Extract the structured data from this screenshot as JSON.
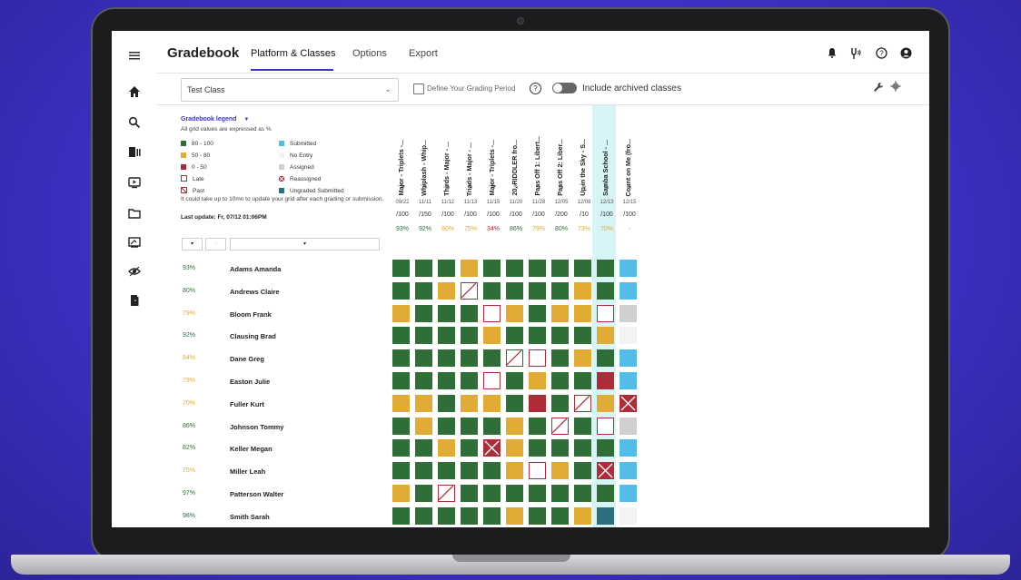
{
  "header": {
    "brand": "Gradebook",
    "tabs": [
      "Platform & Classes",
      "Options",
      "Export"
    ]
  },
  "sidebar": {
    "icons": [
      "menu-icon",
      "home-icon",
      "search-icon",
      "library-icon",
      "play-icon",
      "folder-icon",
      "chalkboard-icon",
      "eye-icon",
      "door-icon"
    ]
  },
  "toolbar": {
    "class_select": "Test Class",
    "period_label": "Define Your Grading Period",
    "archived_label": "Include archived classes"
  },
  "legend": {
    "title": "Gradebook legend",
    "subtitle": "All grid values are expressed as %",
    "items_left": [
      "80 - 100",
      "50 - 80",
      "0 - 50",
      "Late",
      "Past"
    ],
    "items_right": [
      "Submitted",
      "No Entry",
      "Assigned",
      "Reassigned",
      "Ungraded Submitted"
    ],
    "note": "It could take up to 10mn to update your grid after each grading or submission.",
    "last_update": "Last update: Fr, 07/12 01:06PM"
  },
  "filters": {
    "first": "▾",
    "second": "-",
    "third": "▾"
  },
  "colors": {
    "green": "#2f6e36",
    "yellow": "#e2ac34",
    "red": "#ae2c38",
    "blue": "#53bde9",
    "grey": "#cfcfcf",
    "teal": "#2c6f7f",
    "accent": "#3d33c6"
  },
  "columns": [
    {
      "title": "Major - Triplets -...",
      "date": "09/22",
      "max": "/100",
      "avg": "93%",
      "avg_color": "#2f6e36"
    },
    {
      "title": "Whiplash - Whip...",
      "date": "11/11",
      "max": "/150",
      "avg": "92%",
      "avg_color": "#2f6e36"
    },
    {
      "title": "Thirds - Major - ...",
      "date": "11/12",
      "max": "/100",
      "avg": "80%",
      "avg_color": "#e2ac34"
    },
    {
      "title": "Triads - Major - ...",
      "date": "11/13",
      "max": "/100",
      "avg": "75%",
      "avg_color": "#e2ac34"
    },
    {
      "title": "Major - Triplets -...",
      "date": "11/15",
      "max": "/100",
      "avg": "34%",
      "avg_color": "#ae2c38"
    },
    {
      "title": "20. RIDDLER fro...",
      "date": "11/20",
      "max": "/100",
      "avg": "86%",
      "avg_color": "#2f6e36"
    },
    {
      "title": "Pass Off 1: Libert...",
      "date": "11/28",
      "max": "/100",
      "avg": "79%",
      "avg_color": "#e2ac34"
    },
    {
      "title": "Pass Off 2: Liber...",
      "date": "12/05",
      "max": "/200",
      "avg": "80%",
      "avg_color": "#2f6e36"
    },
    {
      "title": "Up in the Sky - S...",
      "date": "12/08",
      "max": "/10",
      "avg": "73%",
      "avg_color": "#e2ac34"
    },
    {
      "title": "Samba School - ...",
      "date": "12/13",
      "max": "/100",
      "avg": "70%",
      "avg_color": "#e2ac34"
    },
    {
      "title": "Count on Me (fro...",
      "date": "12/15",
      "max": "/100",
      "avg": "-",
      "avg_color": "#999999"
    }
  ],
  "students": [
    {
      "name": "Adams Amanda",
      "pct": "93%",
      "pct_color": "#2f6e36",
      "cells": [
        "g",
        "g",
        "g",
        "y",
        "g",
        "g",
        "g",
        "g",
        "g",
        "g",
        "b"
      ]
    },
    {
      "name": "Andrews  Claire",
      "pct": "80%",
      "pct_color": "#2f6e36",
      "cells": [
        "g",
        "g",
        "y",
        "p",
        "g",
        "g",
        "g",
        "g",
        "y",
        "g",
        "b"
      ]
    },
    {
      "name": "Bloom Frank",
      "pct": "79%",
      "pct_color": "#e2ac34",
      "cells": [
        "y",
        "g",
        "g",
        "g",
        "l",
        "y",
        "g",
        "y",
        "y",
        "l",
        "gr"
      ]
    },
    {
      "name": "Clausing Brad",
      "pct": "92%",
      "pct_color": "#2f6e36",
      "cells": [
        "g",
        "g",
        "g",
        "g",
        "y",
        "g",
        "g",
        "g",
        "g",
        "y",
        "ne"
      ]
    },
    {
      "name": "Dane Greg",
      "pct": "84%",
      "pct_color": "#e2ac34",
      "cells": [
        "g",
        "g",
        "g",
        "g",
        "g",
        "p",
        "l",
        "g",
        "y",
        "g",
        "b"
      ]
    },
    {
      "name": "Easton Julie",
      "pct": "79%",
      "pct_color": "#e2ac34",
      "cells": [
        "g",
        "g",
        "g",
        "g",
        "l",
        "g",
        "y",
        "g",
        "g",
        "r",
        "b"
      ]
    },
    {
      "name": "Fuller Kurt",
      "pct": "70%",
      "pct_color": "#e2ac34",
      "cells": [
        "y",
        "y",
        "g",
        "y",
        "y",
        "g",
        "r",
        "g",
        "p",
        "y",
        "x"
      ]
    },
    {
      "name": "Johnson Tommy",
      "pct": "86%",
      "pct_color": "#2f6e36",
      "cells": [
        "g",
        "y",
        "g",
        "g",
        "g",
        "y",
        "g",
        "p",
        "g",
        "l",
        "gr"
      ]
    },
    {
      "name": "Keller Megan",
      "pct": "82%",
      "pct_color": "#2f6e36",
      "cells": [
        "g",
        "g",
        "y",
        "g",
        "x",
        "y",
        "g",
        "g",
        "g",
        "g",
        "b"
      ]
    },
    {
      "name": "Miller Leah",
      "pct": "75%",
      "pct_color": "#e2ac34",
      "cells": [
        "g",
        "g",
        "g",
        "g",
        "g",
        "y",
        "l",
        "y",
        "g",
        "x",
        "b"
      ]
    },
    {
      "name": "Patterson Walter",
      "pct": "97%",
      "pct_color": "#2f6e36",
      "cells": [
        "y",
        "g",
        "p",
        "g",
        "g",
        "g",
        "g",
        "g",
        "g",
        "g",
        "b"
      ]
    },
    {
      "name": "Smith Sarah",
      "pct": "98%",
      "pct_color": "#2f6e36",
      "cells": [
        "g",
        "g",
        "g",
        "g",
        "g",
        "y",
        "g",
        "g",
        "y",
        "t",
        "ne"
      ]
    }
  ]
}
